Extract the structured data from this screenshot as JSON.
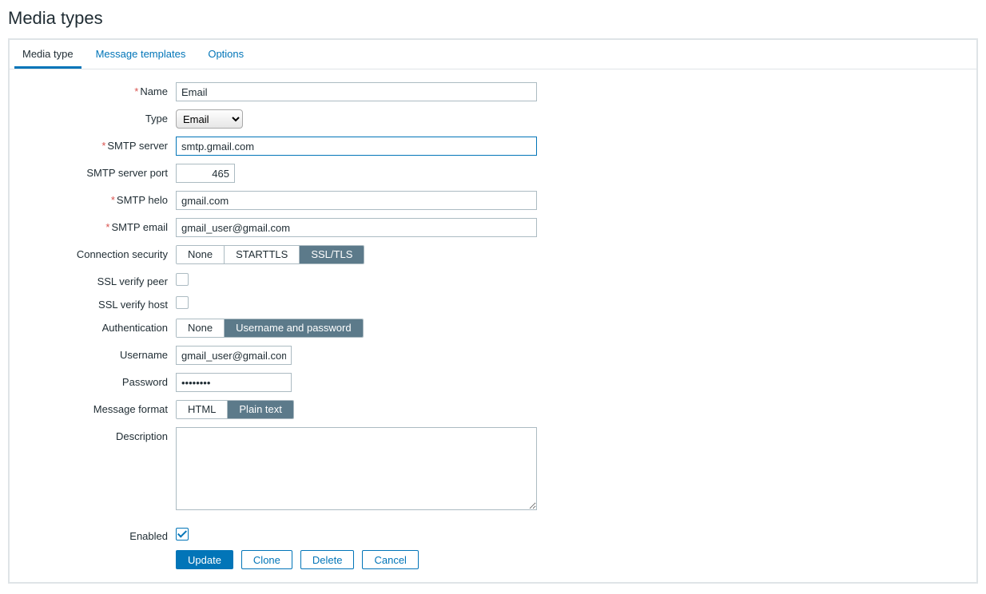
{
  "page_title": "Media types",
  "tabs": {
    "media_type": "Media type",
    "message_templates": "Message templates",
    "options": "Options"
  },
  "form": {
    "labels": {
      "name": "Name",
      "type": "Type",
      "smtp_server": "SMTP server",
      "smtp_port": "SMTP server port",
      "smtp_helo": "SMTP helo",
      "smtp_email": "SMTP email",
      "connection_security": "Connection security",
      "ssl_verify_peer": "SSL verify peer",
      "ssl_verify_host": "SSL verify host",
      "authentication": "Authentication",
      "username": "Username",
      "password": "Password",
      "message_format": "Message format",
      "description": "Description",
      "enabled": "Enabled"
    },
    "values": {
      "name": "Email",
      "type": "Email",
      "smtp_server": "smtp.gmail.com",
      "smtp_port": "465",
      "smtp_helo": "gmail.com",
      "smtp_email": "gmail_user@gmail.com",
      "username": "gmail_user@gmail.com",
      "password": "••••••••",
      "description": ""
    },
    "segments": {
      "connection_security": {
        "none": "None",
        "starttls": "STARTTLS",
        "ssltls": "SSL/TLS"
      },
      "authentication": {
        "none": "None",
        "userpass": "Username and password"
      },
      "message_format": {
        "html": "HTML",
        "plain": "Plain text"
      }
    }
  },
  "buttons": {
    "update": "Update",
    "clone": "Clone",
    "delete": "Delete",
    "cancel": "Cancel"
  }
}
